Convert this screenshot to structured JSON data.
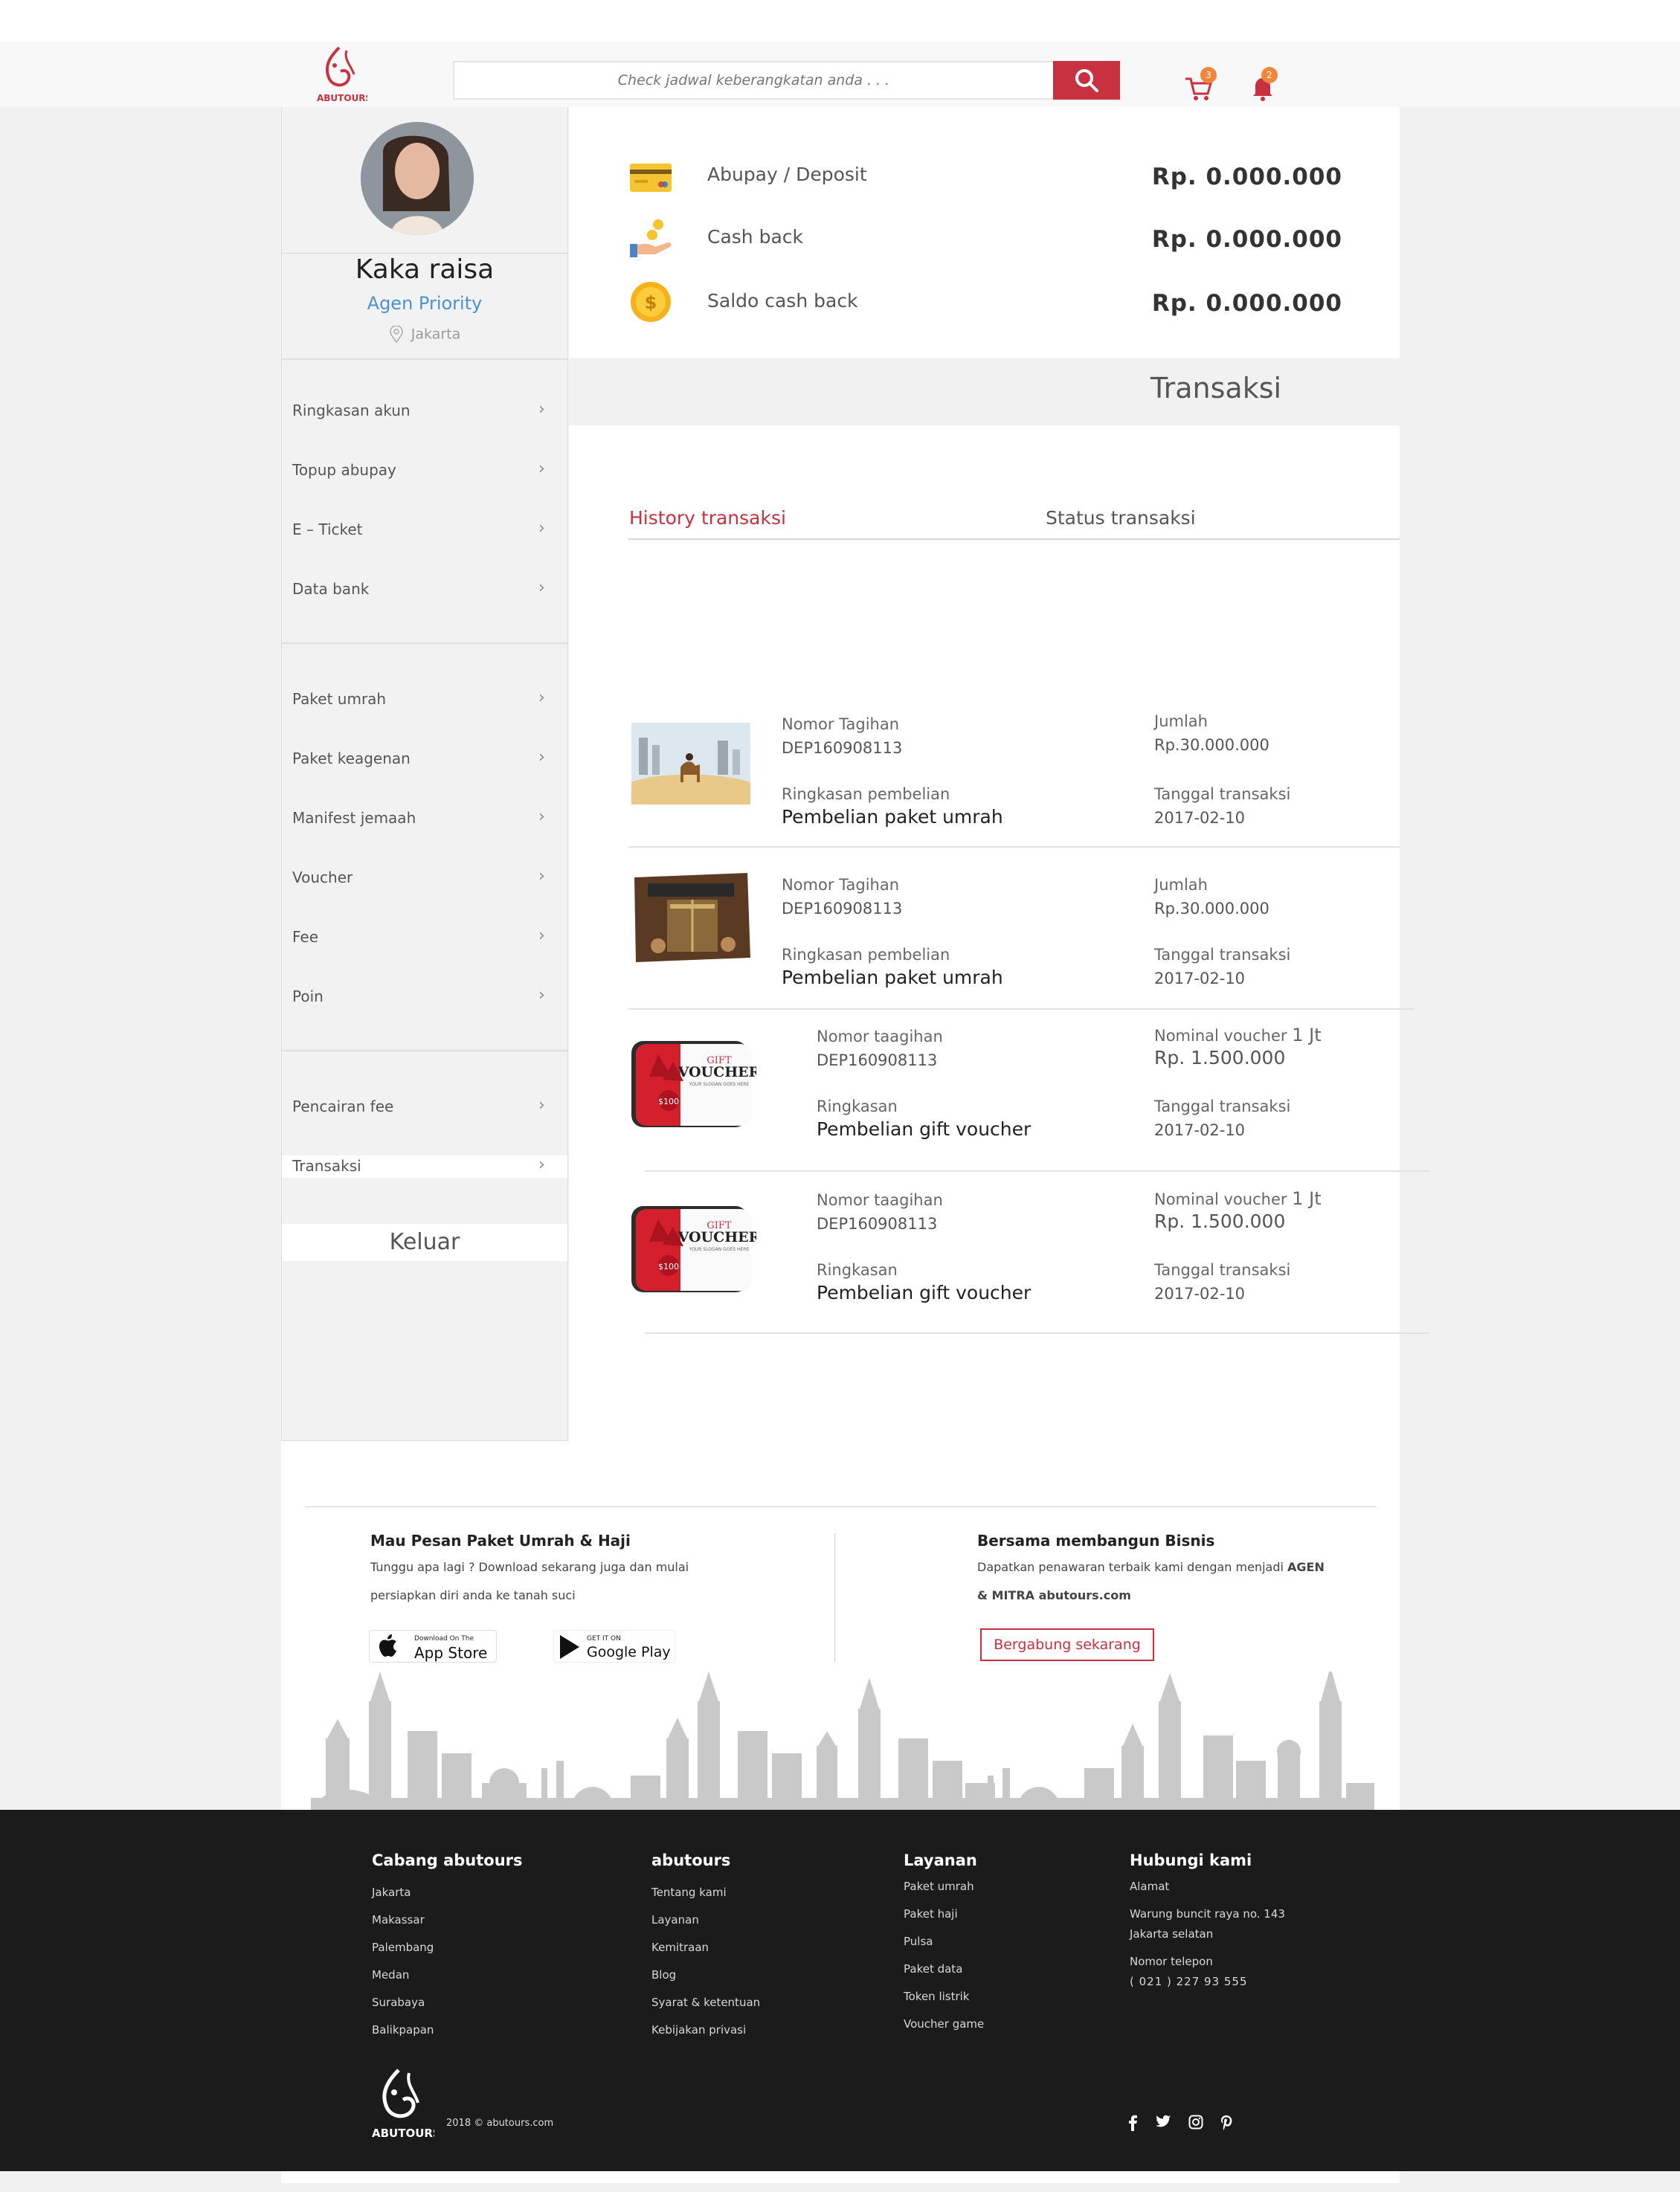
{
  "header": {
    "search_placeholder": "Check jadwal keberangkatan anda . . .",
    "cart_count": "3",
    "notif_count": "2",
    "brand": "ABUTOURS"
  },
  "profile": {
    "name": "Kaka raisa",
    "role": "Agen Priority",
    "location": "Jakarta"
  },
  "menu": {
    "group1": [
      "Ringkasan akun",
      "Topup abupay",
      "E – Ticket",
      "Data bank"
    ],
    "group2": [
      "Paket umrah",
      "Paket keagenan",
      "Manifest jemaah",
      "Voucher",
      "Fee",
      "Poin"
    ],
    "group3": [
      "Pencairan fee",
      "Transaksi"
    ],
    "logout": "Keluar",
    "chevron": "›"
  },
  "balances": [
    {
      "label": "Abupay / Deposit",
      "value": "Rp.  0.000.000",
      "icon": "credit-card-icon"
    },
    {
      "label": "Cash back",
      "value": "Rp.  0.000.000",
      "icon": "cashback-hand-icon"
    },
    {
      "label": "Saldo cash back",
      "value": "Rp.  0.000.000",
      "icon": "dollar-coin-icon"
    }
  ],
  "transaksi": {
    "title": "Transaksi",
    "tabs": [
      "History transaksi",
      "Status transaksi"
    ],
    "rows": [
      {
        "l1": "Nomor Tagihan",
        "v1": "DEP160908113",
        "l2": "Ringkasan pembelian",
        "v2": "Pembelian paket umrah",
        "l3": "Jumlah",
        "v3": "Rp.30.000.000",
        "l4": "Tanggal transaksi",
        "v4": "2017-02-10"
      },
      {
        "l1": "Nomor Tagihan",
        "v1": "DEP160908113",
        "l2": "Ringkasan pembelian",
        "v2": "Pembelian paket umrah",
        "l3": "Jumlah",
        "v3": "Rp.30.000.000",
        "l4": "Tanggal transaksi",
        "v4": "2017-02-10"
      },
      {
        "l1": "Nomor taagihan",
        "v1": "DEP160908113",
        "l2": "Ringkasan",
        "v2": "Pembelian gift voucher",
        "l3a": "Nominal voucher",
        "l3b": "1 Jt",
        "v3": "Rp. 1.500.000",
        "l4": "Tanggal transaksi",
        "v4": "2017-02-10"
      },
      {
        "l1": "Nomor taagihan",
        "v1": "DEP160908113",
        "l2": "Ringkasan",
        "v2": "Pembelian gift voucher",
        "l3a": "Nominal voucher",
        "l3b": "1 Jt",
        "v3": "Rp. 1.500.000",
        "l4": "Tanggal transaksi",
        "v4": "2017-02-10"
      }
    ],
    "voucher_card": {
      "gift": "GIFT",
      "voucher": "VOUCHER",
      "slogan": "YOUR SLOGAN GOES HERE",
      "amount": "$100"
    }
  },
  "footer_top": {
    "left_title": "Mau Pesan Paket Umrah & Haji",
    "left_line1": "Tunggu apa lagi ? Download sekarang juga dan mulai",
    "left_line2": "persiapkan diri anda ke tanah suci",
    "appstore_small": "Download On The",
    "appstore_big": "App Store",
    "gplay_small": "GET IT ON",
    "gplay_big": "Google Play",
    "right_title": "Bersama membangun Bisnis",
    "right_line1": "Dapatkan penawaran terbaik kami dengan menjadi",
    "right_line1_bold": "AGEN",
    "right_line2_bold": "& MITRA abutours.com",
    "join_label": "Bergabung sekarang"
  },
  "footer": {
    "cabang": {
      "title": "Cabang abutours",
      "items": [
        "Jakarta",
        "Makassar",
        "Palembang",
        "Medan",
        "Surabaya",
        "Balikpapan"
      ]
    },
    "abutours": {
      "title": "abutours",
      "items": [
        "Tentang kami",
        "Layanan",
        "Kemitraan",
        "Blog",
        "Syarat & ketentuan",
        "Kebijakan privasi"
      ]
    },
    "layanan": {
      "title": "Layanan",
      "items": [
        "Paket umrah",
        "Paket haji",
        "Pulsa",
        "Paket data",
        "Token listrik",
        "Voucher game"
      ]
    },
    "hubungi": {
      "title": "Hubungi kami",
      "alamat_label": "Alamat",
      "alamat1": "Warung buncit raya no. 143",
      "alamat2": "Jakarta selatan",
      "telp_label": "Nomor telepon",
      "telp": "( 021 )  227 93 555"
    },
    "copyright": "2018 © abutours.com",
    "socials": [
      "facebook-icon",
      "twitter-icon",
      "instagram-icon",
      "pinterest-icon"
    ]
  }
}
